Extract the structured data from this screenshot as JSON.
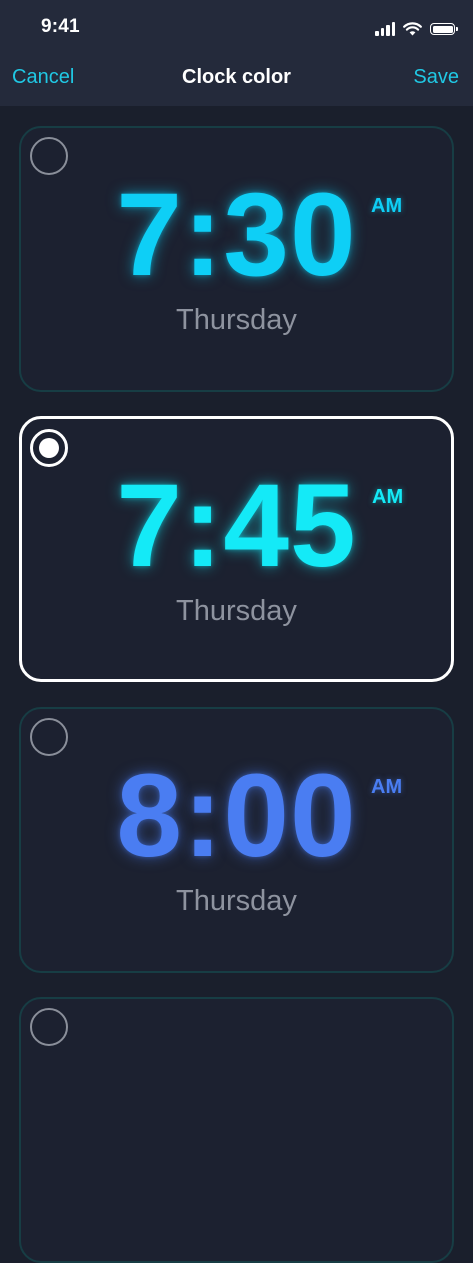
{
  "status_bar": {
    "time": "9:41",
    "icons": [
      "cellular-signal-icon",
      "wifi-icon",
      "battery-icon"
    ]
  },
  "nav": {
    "cancel_label": "Cancel",
    "title": "Clock color",
    "save_label": "Save",
    "accent_color": "#20c8e4"
  },
  "options": [
    {
      "time": "7:30",
      "ampm": "AM",
      "day": "Thursday",
      "color": "#0ecff6",
      "selected": false
    },
    {
      "time": "7:45",
      "ampm": "AM",
      "day": "Thursday",
      "color": "#14eaf7",
      "selected": true
    },
    {
      "time": "8:00",
      "ampm": "AM",
      "day": "Thursday",
      "color": "#4a7df2",
      "selected": false
    }
  ]
}
